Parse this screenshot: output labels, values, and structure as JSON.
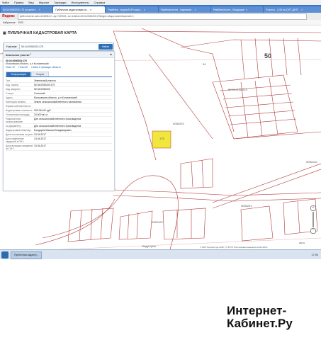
{
  "browser": {
    "menu": [
      "Файл",
      "Правка",
      "Вид",
      "Журнал",
      "Закладки",
      "Инструменты",
      "Справка"
    ],
    "tabs": [
      {
        "label": "50:34:0050203:175 росреест...",
        "active": false
      },
      {
        "label": "Публичная кадастровая ка...",
        "active": true
      },
      {
        "label": "Рамблер - модный ИН жари...",
        "active": false
      },
      {
        "label": "Рамблер/почта - надежная...",
        "active": false
      },
      {
        "label": "Рамблер/почта - Входящие",
        "active": false
      },
      {
        "label": "Участок - 2.45 га (СНТ, ДНП...",
        "active": false
      }
    ],
    "logo": "Яндекс",
    "url": "pkk5.rosreestr.ru/#x=4165034.2...&y=7429533...&z=14&text=50:34:0050203:175&type=1&app=search&opened=1",
    "bookmarks": [
      "Избранное",
      "ЕИЗ"
    ]
  },
  "site": {
    "title": "ПУБЛИЧНАЯ КАДАСТРОВАЯ КАРТА",
    "search_type": "Участок",
    "search_value": "50:34:0050203:175",
    "search_button": "Найти"
  },
  "panel": {
    "header": "Земельные участки",
    "header_count": "1",
    "object_number": "50:34:0050203:175",
    "object_address": "Московская область, р-н Коломенский",
    "links": [
      "План ЗУ",
      "План КК",
      "Найти в границах объекта"
    ],
    "tabs": [
      "Информация",
      "Услуги"
    ],
    "rows": [
      {
        "k": "Тип:",
        "v": "Земельный участок"
      },
      {
        "k": "Кад. номер:",
        "v": "50:34:0050203:175"
      },
      {
        "k": "Кад. квартал:",
        "v": "50:34:0050203"
      },
      {
        "k": "Статус:",
        "v": "Учтенный"
      },
      {
        "k": "Адрес:",
        "v": "Московская область, р-н Коломенский"
      },
      {
        "k": "Категория земель:",
        "v": "Земли сельскохозяйственного назначения"
      },
      {
        "k": "Форма собственности:",
        "v": ""
      },
      {
        "k": "Кадастровая стоимость:",
        "v": "305 064,00 руб."
      },
      {
        "k": "Уточненная площадь:",
        "v": "24 600 кв. м"
      },
      {
        "k": "Разрешенное использование:",
        "v": "Для сельскохозяйственного производства"
      },
      {
        "k": "по документу:",
        "v": "Для сельскохозяйственного производства"
      },
      {
        "k": "Кадастровый инженер:",
        "v": "Бондарев Максим Владимирович"
      },
      {
        "k": "Дата постановки на учет:",
        "v": "13.04.2017"
      },
      {
        "k": "Дата изменения сведений в ГКН:",
        "v": "13.04.2017"
      },
      {
        "k": "Дата выгрузки сведений из ГКН:",
        "v": "13.04.2017"
      }
    ]
  },
  "map": {
    "labels": [
      "50:34:0050214",
      "0050203",
      "0050102",
      "0050201",
      "0050102",
      "175",
      "Индустрия",
      "50",
      "50",
      "34"
    ],
    "copyright": "© ФКП Росреестра 2010 | © ФГУП Ростехинвентаризация 2010-2013",
    "scale": "200 м"
  },
  "taskbar": {
    "button": "Публичная кадастр...",
    "clock": "17:00"
  },
  "watermark": {
    "line1": "Интернет-",
    "line2": "Кабинет.Ру"
  }
}
